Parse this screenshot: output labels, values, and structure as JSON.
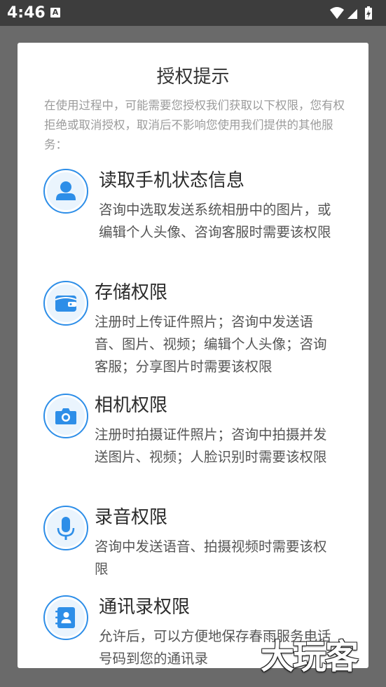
{
  "status_bar": {
    "time": "4:46",
    "notification_icon": "a-icon",
    "wifi_icon": "wifi-icon",
    "signal_icon": "signal-icon",
    "battery_icon": "battery-charging-icon"
  },
  "dialog": {
    "title": "授权提示",
    "intro": "在使用过程中，可能需要您授权我们获取以下权限，您有权拒绝或取消授权，取消后不影响您使用我们提供的其他服务：",
    "permissions": [
      {
        "icon": "user-icon",
        "title": "读取手机状态信息",
        "desc": "咨询中选取发送系统相册中的图片，或编辑个人头像、咨询客服时需要该权限"
      },
      {
        "icon": "wallet-icon",
        "title": "存储权限",
        "desc": "注册时上传证件照片；咨询中发送语音、图片、视频；编辑个人头像；咨询客服；分享图片时需要该权限"
      },
      {
        "icon": "camera-icon",
        "title": "相机权限",
        "desc": "注册时拍摄证件照片；咨询中拍摄并发送图片、视频；人脸识别时需要该权限"
      },
      {
        "icon": "microphone-icon",
        "title": "录音权限",
        "desc": "咨询中发送语音、拍摄视频时需要该权限"
      },
      {
        "icon": "contacts-icon",
        "title": "通讯录权限",
        "desc": "允许后，可以方便地保存春雨服务电话号码到您的通讯录"
      }
    ]
  },
  "watermark": {
    "text": "大玩客"
  },
  "colors": {
    "accent": "#2d8ee8",
    "icon_bg": "#eaf4fd",
    "title": "#2b2b2b",
    "desc": "#555555",
    "intro": "#9b9b9b",
    "status_bar": "#3d3d3d",
    "scrim": "#6a6a6a"
  }
}
